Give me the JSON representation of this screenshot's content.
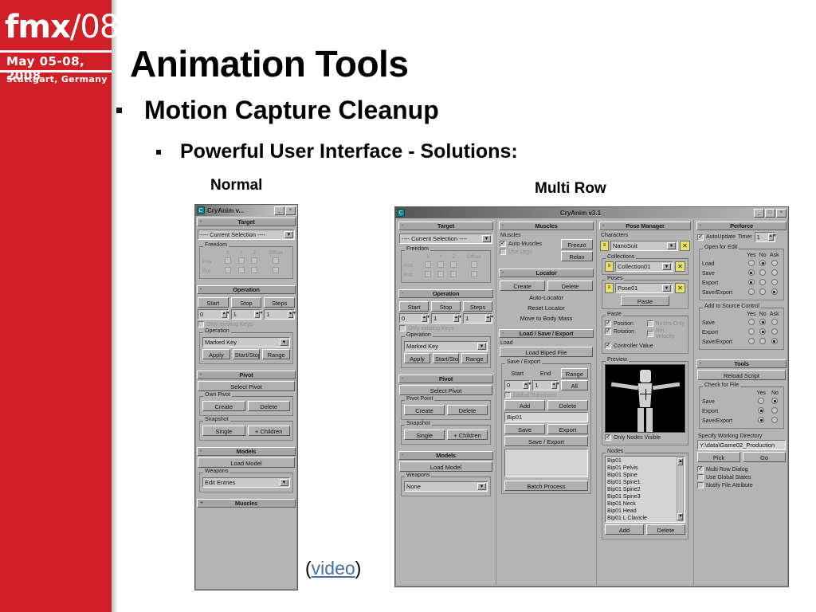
{
  "sidebar": {
    "logo": "fmx",
    "logo_suffix": "/08",
    "date": "May 05-08, 2008",
    "city": "Stuttgart, Germany",
    "bg_color": "#cf2028"
  },
  "slide": {
    "title": "Animation Tools",
    "bullet1": "Motion Capture Cleanup",
    "bullet2": "Powerful User Interface - Solutions:",
    "caption_left": "Normal",
    "caption_right": "Multi Row",
    "video_open": "(",
    "video_label": "video",
    "video_close": ")"
  },
  "normal_window": {
    "title": "CryAnim v...",
    "minimize": "_",
    "close": "×",
    "rollouts": {
      "target": "Target",
      "operation": "Operation",
      "pivot": "Pivot",
      "models": "Models",
      "muscles": "Muscles"
    },
    "target": {
      "selection": "---- Current Selection ----",
      "freedom_label": "Freedom",
      "axes": [
        "X",
        "Y",
        "Z",
        "Offset"
      ],
      "rows": [
        "Pos",
        "Rot"
      ]
    },
    "operation": {
      "start_label": "Start",
      "stop_label": "Stop",
      "steps_label": "Steps",
      "start_value": "0",
      "stop_value": "1",
      "steps_value": "1",
      "only_existing": "Only existing Keys",
      "group_label": "Operation",
      "dropdown": "Marked Key",
      "apply": "Apply",
      "startstop": "Start/Stop",
      "range": "Range"
    },
    "pivot": {
      "select_pivot": "Select Pivot",
      "own_pivot_label": "Own Pivot",
      "create": "Create",
      "delete": "Delete",
      "snapshot_label": "Snapshot",
      "single": "Single",
      "children": "+ Children"
    },
    "models": {
      "load_model": "Load Model",
      "weapons_label": "Weapons",
      "weapons_value": "Edit Entries"
    }
  },
  "multirow_window": {
    "title": "CryAnim v3.1",
    "minimize": "_",
    "maximize": "□",
    "close": "×",
    "col1": {
      "target_rollout": "Target",
      "selection": "---- Current Selection ----",
      "freedom_label": "Freedom",
      "axes": [
        "X",
        "Y",
        "Z",
        "Offset"
      ],
      "rows": [
        "Pos",
        "Rot"
      ],
      "operation_rollout": "Operation",
      "start_label": "Start",
      "stop_label": "Stop",
      "steps_label": "Steps",
      "start_value": "0",
      "stop_value": "1",
      "steps_value": "1",
      "only_existing": "Only existing Keys",
      "operation_group": "Operation",
      "operation_value": "Marked Key",
      "apply": "Apply",
      "startstop": "Start/Stop",
      "range": "Range",
      "pivot_rollout": "Pivot",
      "select_pivot": "Select Pivot",
      "own_pivot_label": "Pivot Point",
      "create": "Create",
      "delete": "Delete",
      "snapshot_label": "Snapshot",
      "single": "Single",
      "children": "+ Children",
      "models_rollout": "Models",
      "load_model": "Load Model",
      "weapons_label": "Weapons",
      "weapons_value": "None"
    },
    "col2": {
      "muscles_rollout": "Muscles",
      "muscles_label": "Muscles",
      "auto_muscles": "Auto Muscles",
      "use_legs": "Use Legs",
      "freeze": "Freeze",
      "relax": "Relax",
      "locator_rollout": "Locator",
      "create": "Create",
      "delete": "Delete",
      "auto_locator": "Auto-Locator",
      "reset_locator": "Reset Locator",
      "move_body_mass": "Move to Body Mass",
      "loadsave_rollout": "Load / Save / Export",
      "load_label": "Load",
      "load_biped": "Load Biped File",
      "saveexport_label": "Save / Export",
      "start_label": "Start",
      "end_label": "End",
      "range_label": "Range",
      "start_value": "0",
      "end_value": "1",
      "all": "All",
      "global_transform": "Global Transform",
      "add": "Add",
      "delete2": "Delete",
      "node_value": "Bip01",
      "save": "Save",
      "export": "Export",
      "save_export": "Save / Export",
      "batch_process": "Batch Process"
    },
    "col3": {
      "pose_rollout": "Pose Manager",
      "characters_label": "Characters",
      "characters_value": "NanoSuit",
      "collections_label": "Collections",
      "collections_value": "Collection01",
      "poses_label": "Poses",
      "poses_value": "Pose01",
      "paste_btn": "Paste",
      "paste_group": "Paste",
      "cb_position": "Position",
      "cb_nodes_only": "Nodes Only",
      "cb_rotation": "Rotation",
      "cb_rel_velocity": "Rel. Velocity",
      "cb_controller_value": "Controller Value",
      "preview_label": "Preview",
      "only_nodes_visible": "Only Nodes Visible",
      "nodes_label": "Nodes",
      "nodes": [
        "Bip01",
        "Bip01 Pelvis",
        "Bip01 Spine",
        "Bip01 Spine1",
        "Bip01 Spine2",
        "Bip01 Spine3",
        "Bip01 Neck",
        "Bip01 Head",
        "Bip01 L Clavicle"
      ],
      "add": "Add",
      "delete": "Delete"
    },
    "col4": {
      "perforce_rollout": "Perforce",
      "auto_update": "AutoUpdate",
      "timer_label": "Timer",
      "timer_value": "1",
      "open_for_edit": "Open for Edit",
      "cols": [
        "Yes",
        "No",
        "Ask"
      ],
      "rows_open": [
        {
          "label": "Load",
          "sel": 1
        },
        {
          "label": "Save",
          "sel": 0
        },
        {
          "label": "Export",
          "sel": 0
        },
        {
          "label": "Save/Export",
          "sel": 2
        }
      ],
      "add_source_label": "Add to Source Control",
      "rows_source": [
        {
          "label": "Save",
          "sel": 1
        },
        {
          "label": "Export",
          "sel": 1
        },
        {
          "label": "Save/Export",
          "sel": 2
        }
      ],
      "tools_rollout": "Tools",
      "reload_script": "Reload Script",
      "check_for_file": "Check for File",
      "cols2": [
        "Yes",
        "No"
      ],
      "rows_check": [
        {
          "label": "Save",
          "sel": 1
        },
        {
          "label": "Export",
          "sel": 0
        },
        {
          "label": "Save/Export",
          "sel": 0
        }
      ],
      "working_dir_label": "Specify Working Directory",
      "working_dir_value": "Y:\\data\\Game02_Production",
      "pick": "Pick",
      "go": "Go",
      "multi_row_dialog": "Multi Row Dialog",
      "use_global_states": "Use Global States",
      "notify_file_attribute": "Notify File Attribute"
    }
  }
}
